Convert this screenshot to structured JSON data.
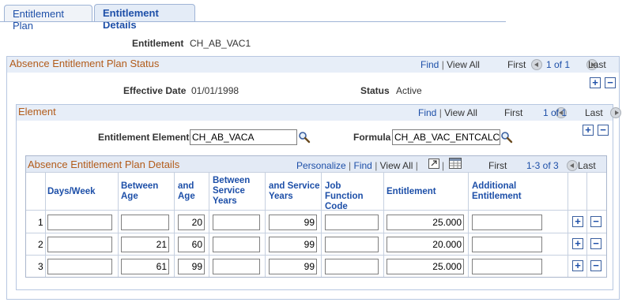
{
  "tabs": [
    {
      "label": "Entitlement Plan",
      "active": false
    },
    {
      "label": "Entitlement Details",
      "active": true
    }
  ],
  "entitlement": {
    "label": "Entitlement",
    "value": "CH_AB_VAC1"
  },
  "plan_status": {
    "title": "Absence Entitlement Plan Status",
    "find": "Find",
    "view_all": "View All",
    "first": "First",
    "count": "1 of 1",
    "last": "Last",
    "effective_date_label": "Effective Date",
    "effective_date": "01/01/1998",
    "status_label": "Status",
    "status": "Active"
  },
  "element": {
    "title": "Element",
    "find": "Find",
    "view_all": "View All",
    "first": "First",
    "count": "1 of 1",
    "last": "Last",
    "entitlement_element_label": "Entitlement Element",
    "entitlement_element": "CH_AB_VACA",
    "formula_label": "Formula",
    "formula": "CH_AB_VAC_ENTCALC"
  },
  "details": {
    "title": "Absence Entitlement Plan Details",
    "personalize": "Personalize",
    "find": "Find",
    "view_all": "View All",
    "first": "First",
    "count": "1-3 of 3",
    "last": "Last",
    "columns": {
      "days_week": "Days/Week",
      "between_age": "Between Age",
      "and_age": "and Age",
      "between_service": "Between Service Years",
      "and_service": "and Service Years",
      "job_function": "Job Function Code",
      "entitlement": "Entitlement",
      "additional": "Additional Entitlement"
    },
    "rows": [
      {
        "num": "1",
        "days_week": "",
        "between_age": "",
        "and_age": "20",
        "between_service": "",
        "and_service": "99",
        "job_function": "",
        "entitlement": "25.000",
        "additional": ""
      },
      {
        "num": "2",
        "days_week": "",
        "between_age": "21",
        "and_age": "60",
        "between_service": "",
        "and_service": "99",
        "job_function": "",
        "entitlement": "20.000",
        "additional": ""
      },
      {
        "num": "3",
        "days_week": "",
        "between_age": "61",
        "and_age": "99",
        "between_service": "",
        "and_service": "99",
        "job_function": "",
        "entitlement": "25.000",
        "additional": ""
      }
    ]
  },
  "icons": {
    "add": "plus-icon",
    "delete": "minus-icon",
    "lookup": "magnifier-icon",
    "zoom": "zoom-icon",
    "download": "spreadsheet-icon"
  }
}
